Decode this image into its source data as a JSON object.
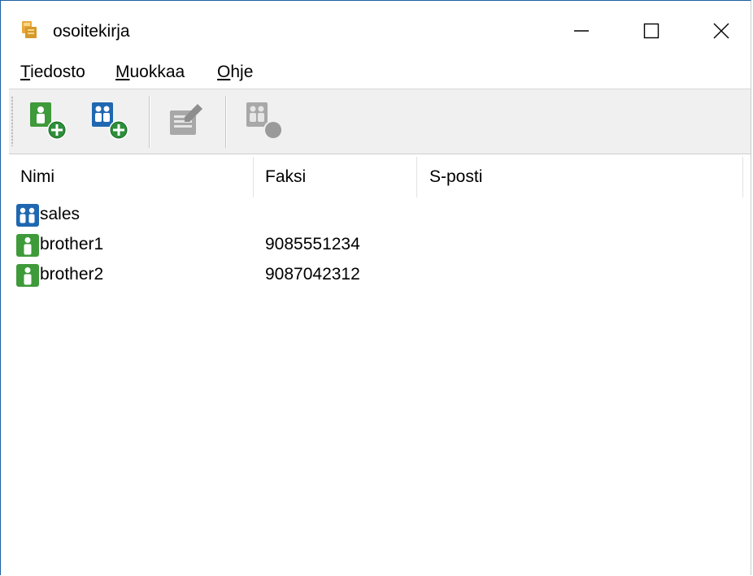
{
  "window": {
    "title": "osoitekirja",
    "controls": [
      "minimize",
      "maximize",
      "close"
    ]
  },
  "menu": [
    {
      "key": "T",
      "rest": "iedosto"
    },
    {
      "key": "M",
      "rest": "uokkaa"
    },
    {
      "key": "O",
      "rest": "hje"
    }
  ],
  "toolbar": {
    "buttons": [
      {
        "icon": "add-contact-icon",
        "enabled": true
      },
      {
        "icon": "add-group-icon",
        "enabled": true
      },
      {
        "icon": "edit-icon",
        "enabled": false
      },
      {
        "icon": "delete-icon",
        "enabled": false
      }
    ]
  },
  "table": {
    "columns": [
      "Nimi",
      "Faksi",
      "S-posti"
    ],
    "rows": [
      {
        "type": "group",
        "icon": "group-icon",
        "name": "sales",
        "fax": "",
        "email": ""
      },
      {
        "type": "contact",
        "icon": "contact-icon",
        "name": "brother1",
        "fax": "9085551234",
        "email": ""
      },
      {
        "type": "contact",
        "icon": "contact-icon",
        "name": "brother2",
        "fax": "9087042312",
        "email": ""
      }
    ]
  },
  "colors": {
    "contact_green": "#3f9a3a",
    "group_blue": "#1f67b1",
    "toolbar_bg": "#f0f0f0",
    "disabled_gray": "#9a9a9a"
  }
}
